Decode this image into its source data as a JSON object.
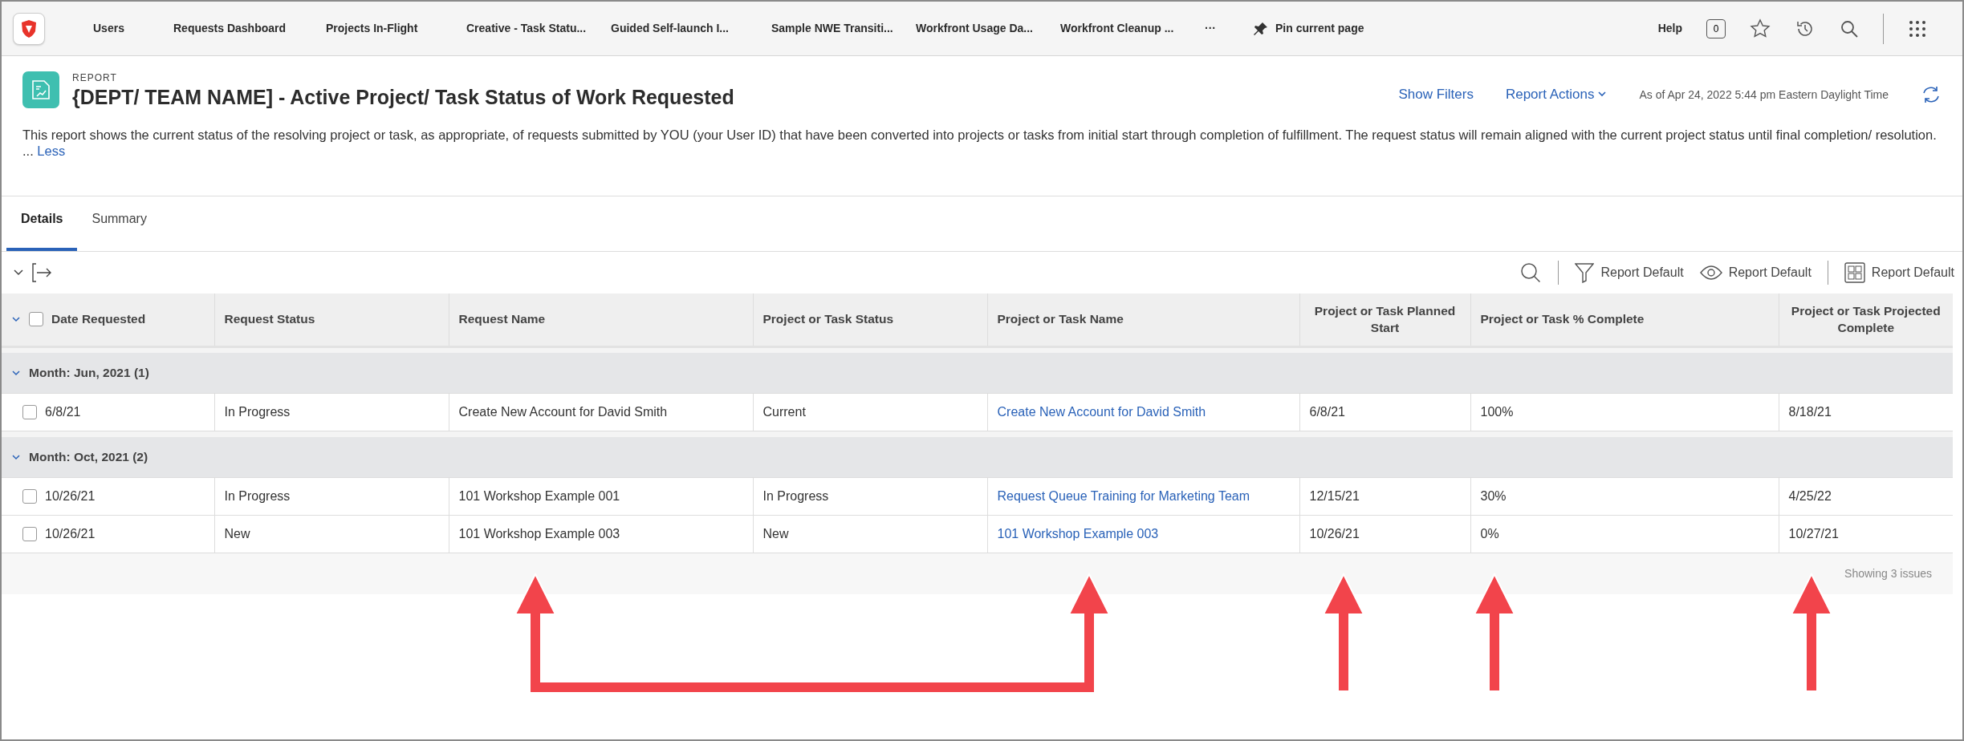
{
  "nav": {
    "items": [
      "Users",
      "Requests Dashboard",
      "Projects In-Flight",
      "Creative - Task Statu...",
      "Guided Self-launch I...",
      "Sample NWE Transiti...",
      "Workfront Usage Da...",
      "Workfront Cleanup ..."
    ],
    "overflow": "···",
    "pin": "Pin current page",
    "help": "Help",
    "notifications": "0"
  },
  "report": {
    "eyebrow": "REPORT",
    "title": "{DEPT/ TEAM NAME] - Active Project/ Task Status of Work Requested",
    "description": "This report shows the current status of the resolving project or task, as appropriate, of requests submitted by YOU (your User ID) that have been converted into projects or tasks from initial start through completion of fulfillment. The request status will remain aligned with the current project status until final completion/ resolution.",
    "less_prefix": "...",
    "less": "Less",
    "show_filters": "Show Filters",
    "report_actions": "Report Actions",
    "timestamp": "As of Apr 24, 2022 5:44 pm Eastern Daylight Time"
  },
  "tabs": [
    {
      "label": "Details",
      "selected": true
    },
    {
      "label": "Summary",
      "selected": false
    }
  ],
  "toolbar": {
    "filter": "Report Default",
    "view": "Report Default",
    "grouping": "Report Default"
  },
  "table": {
    "header_checked": false,
    "columns": [
      {
        "label": "Date Requested",
        "kind": "text"
      },
      {
        "label": "Request Status",
        "kind": "text"
      },
      {
        "label": "Request Name",
        "kind": "text"
      },
      {
        "label": "Project or Task Status",
        "kind": "text"
      },
      {
        "label": "Project or Task Name",
        "kind": "link"
      },
      {
        "label": "Project or Task Planned Start",
        "kind": "text"
      },
      {
        "label": "Project or Task % Complete",
        "kind": "text"
      },
      {
        "label": "Project or Task Projected Complete",
        "kind": "text"
      }
    ],
    "groups": [
      {
        "label": "Month: Jun, 2021 (1)",
        "expanded": true,
        "rows": [
          {
            "checked": false,
            "cells": [
              "6/8/21",
              "In Progress",
              "Create New Account for David Smith",
              "Current",
              "Create New Account for David Smith",
              "6/8/21",
              "100%",
              "8/18/21"
            ]
          }
        ]
      },
      {
        "label": "Month: Oct, 2021 (2)",
        "expanded": true,
        "rows": [
          {
            "checked": false,
            "cells": [
              "10/26/21",
              "In Progress",
              "101 Workshop Example 001",
              "In Progress",
              "Request Queue Training for Marketing Team",
              "12/15/21",
              "30%",
              "4/25/22"
            ]
          },
          {
            "checked": false,
            "cells": [
              "10/26/21",
              "New",
              "101 Workshop Example 003",
              "New",
              "101 Workshop Example 003",
              "10/26/21",
              "0%",
              "10/27/21"
            ]
          }
        ]
      }
    ],
    "footer": "Showing 3 issues"
  }
}
